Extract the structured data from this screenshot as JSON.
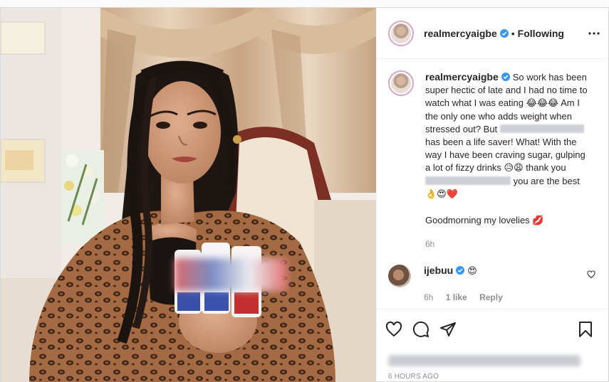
{
  "post": {
    "username": "realmercyaigbe",
    "follow_state": "Following",
    "separator": "•",
    "caption": {
      "line1": "So work has been super hectic of late and I had no time to watch what I was eating ",
      "emoji1": "😂😂😂",
      "line2": " Am I the only one who adds weight when stressed out? But ",
      "line3": "has been a life saver! What! With the way I have been craving sugar, gulping a lot of fizzy drinks ",
      "emoji2": "😥😩",
      "line4": " thank you ",
      "line5": " you are the best ",
      "emoji3": "👌😍❤️",
      "sign_off": "Goodmorning my lovelies ",
      "emoji4": "💋"
    },
    "caption_age": "6h",
    "comments": [
      {
        "username": "ijebuu",
        "text": "😍",
        "age": "6h",
        "likes": "1 like",
        "reply_label": "Reply"
      }
    ],
    "timestamp": "6 HOURS AGO"
  },
  "icons": {
    "verified": "verified-badge-icon",
    "more": "more-options-icon",
    "like": "heart-icon",
    "comment": "comment-icon",
    "share": "share-icon",
    "save": "bookmark-icon"
  },
  "colors": {
    "verified_blue": "#3897f0",
    "text": "#262626",
    "muted": "#8e8e8e",
    "story_ring": "#d8a5c6"
  }
}
